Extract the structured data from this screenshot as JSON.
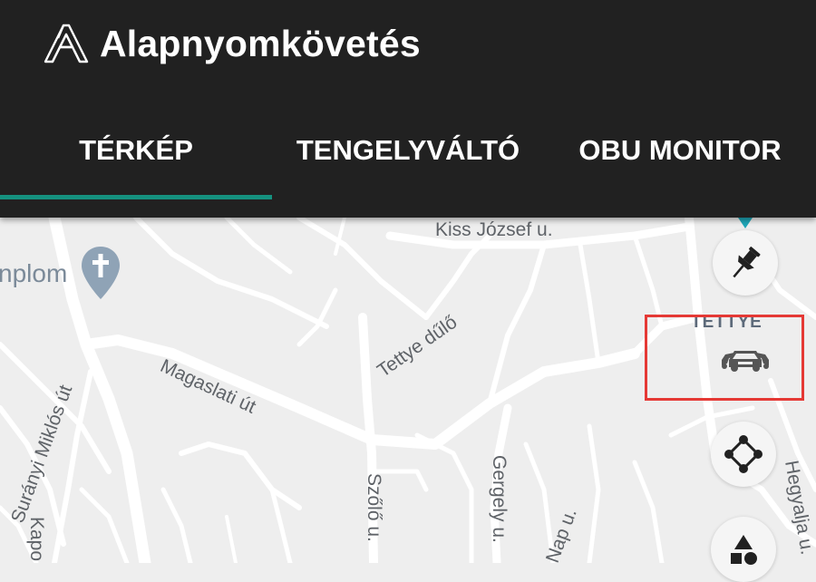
{
  "app": {
    "title": "Alapnyomkövetés"
  },
  "tabs": [
    {
      "label": "TÉRKÉP",
      "selected": true
    },
    {
      "label": "TENGELYVÁLTÓ",
      "selected": false
    },
    {
      "label": "OBU MONITOR",
      "selected": false
    }
  ],
  "colors": {
    "appbar": "#212121",
    "accent": "#15917f",
    "map_bg": "#eeeeee",
    "road": "#ffffff",
    "highlight": "#e53935"
  },
  "map": {
    "poi_label": "nplom",
    "district_label": "TETTYE",
    "streets": [
      "Kiss József u.",
      "Tettye dűlő",
      "Magaslati út",
      "Surányi Miklós út",
      "Szőlő u.",
      "Gergely u.",
      "Nap u.",
      "Hegyalja u.",
      "Kapo"
    ]
  },
  "controls": {
    "pin": "pushpin-icon",
    "vehicles": "cars-icon",
    "route": "route-nodes-icon",
    "shapes": "shapes-icon"
  }
}
